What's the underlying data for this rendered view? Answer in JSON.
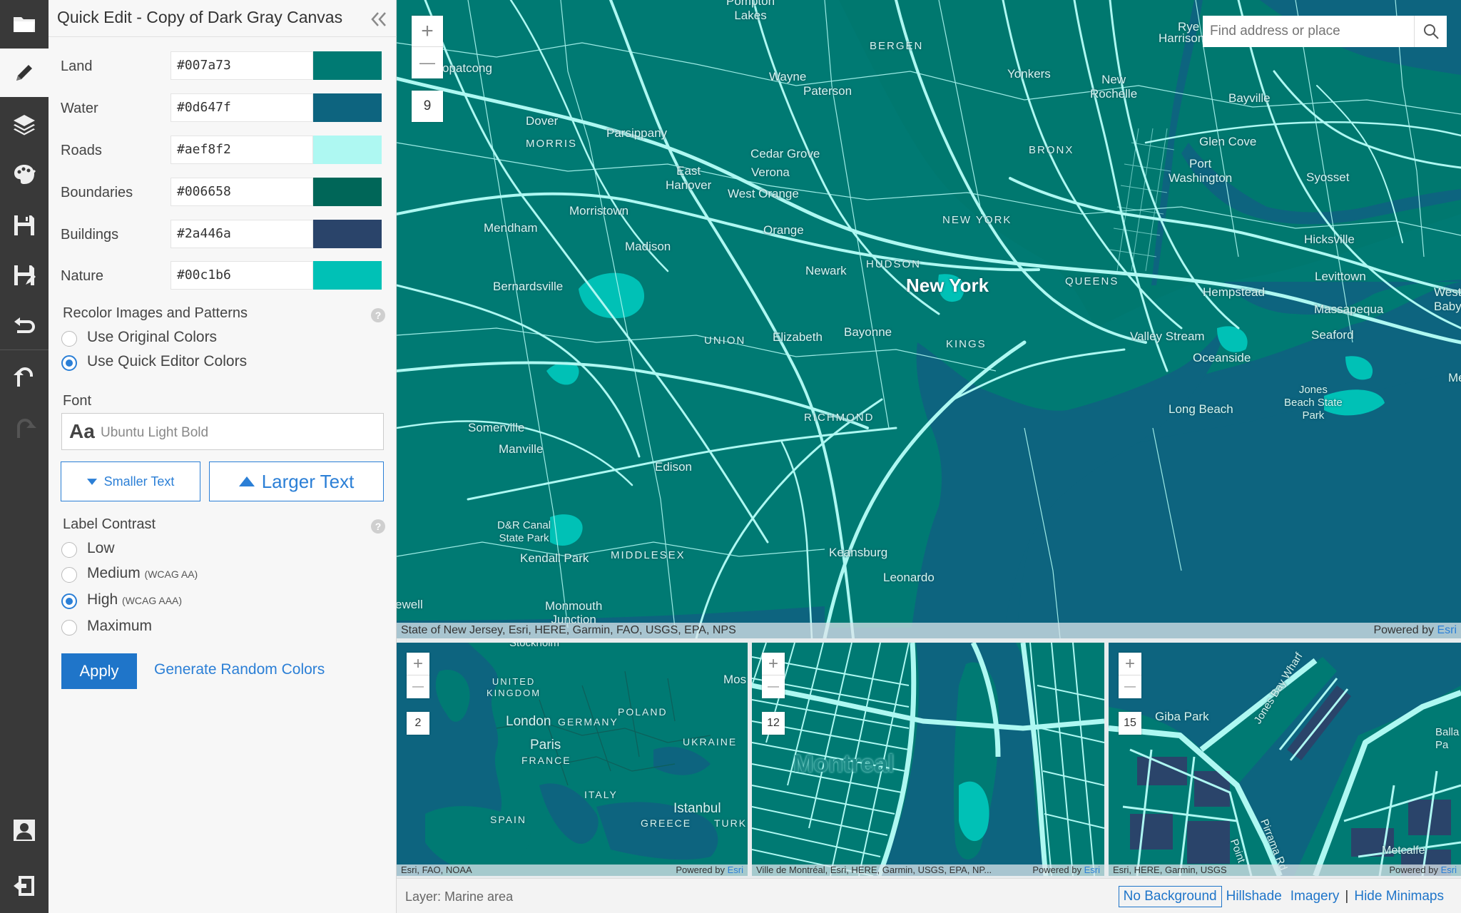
{
  "panel": {
    "title": "Quick Edit - Copy of Dark Gray Canvas",
    "colors": [
      {
        "label": "Land",
        "hex": "#007a73"
      },
      {
        "label": "Water",
        "hex": "#0d647f"
      },
      {
        "label": "Roads",
        "hex": "#aef8f2"
      },
      {
        "label": "Boundaries",
        "hex": "#006658"
      },
      {
        "label": "Buildings",
        "hex": "#2a446a"
      },
      {
        "label": "Nature",
        "hex": "#00c1b6"
      }
    ],
    "recolor": {
      "label": "Recolor Images and Patterns",
      "options": [
        "Use Original Colors",
        "Use Quick Editor Colors"
      ],
      "selected": "Use Quick Editor Colors"
    },
    "font": {
      "label": "Font",
      "icon_text": "Aa",
      "value": "Ubuntu Light Bold"
    },
    "smaller_text": "Smaller Text",
    "larger_text": "Larger Text",
    "contrast": {
      "label": "Label Contrast",
      "options": [
        {
          "label": "Low",
          "note": ""
        },
        {
          "label": "Medium",
          "note": "(WCAG AA)"
        },
        {
          "label": "High",
          "note": "(WCAG AAA)"
        },
        {
          "label": "Maximum",
          "note": ""
        }
      ],
      "selected": "High"
    },
    "help": "?",
    "apply": "Apply",
    "random": "Generate Random Colors"
  },
  "toolbar": {
    "icons": [
      "folder-icon",
      "pencil-icon",
      "layers-icon",
      "palette-icon",
      "save-icon",
      "save-as-icon",
      "revert-icon",
      "undo-icon",
      "redo-icon",
      "user-icon",
      "sign-out-icon"
    ],
    "active": "pencil-icon"
  },
  "map": {
    "zoom_in": "+",
    "zoom_out": "—",
    "zoom_level": "9",
    "search_placeholder": "Find address or place",
    "attribution": "State of New Jersey, Esri, HERE, Garmin, FAO, USGS, EPA, NPS",
    "powered_by": "Powered by",
    "powered_by_brand": "Esri",
    "labels": {
      "pompton_lakes": "Pompton\nLakes",
      "bergen": "BERGEN",
      "rye": "Rye",
      "harrison": "Harrison",
      "opatcong": "opatcong",
      "wayne": "Wayne",
      "paterson": "Paterson",
      "yonkers": "Yonkers",
      "new_rochelle": "New\nRochelle",
      "bayville": "Bayville",
      "dover": "Dover",
      "morris": "MORRIS",
      "parsippany": "Parsippany",
      "cedar_grove": "Cedar Grove",
      "verona": "Verona",
      "bronx": "BRONX",
      "glen_cove": "Glen Cove",
      "east_hanover": "East\nHanover",
      "west_orange": "West Orange",
      "port_washington": "Port\nWashington",
      "syosset": "Syosset",
      "morristown": "Morristown",
      "new_york_caps": "NEW YORK",
      "mendham": "Mendham",
      "orange": "Orange",
      "madison": "Madison",
      "hicksville": "Hicksville",
      "hudson": "HUDSON",
      "newark": "Newark",
      "new_york": "New York",
      "queens": "QUEENS",
      "levittown": "Levittown",
      "bernardsville": "Bernardsville",
      "hempstead": "Hempstead",
      "west_babylon": "West\nBabylon",
      "massapequa": "Massapequa",
      "bayonne": "Bayonne",
      "union": "UNION",
      "elizabeth": "Elizabeth",
      "kings": "KINGS",
      "valley_stream": "Valley Stream",
      "seaford": "Seaford",
      "oceanside": "Oceanside",
      "me": "Me",
      "jones_beach": "Jones\nBeach State\nPark",
      "richmond": "RICHMOND",
      "long_beach": "Long Beach",
      "somerville": "Somerville",
      "manville": "Manville",
      "edison": "Edison",
      "dr_canal": "D&R Canal\nState Park",
      "kendall_park": "Kendall Park",
      "middlesex": "MIDDLESEX",
      "keansburg": "Keansburg",
      "leonardo": "Leonardo",
      "ewell": "ewell",
      "monmouth_junction": "Monmouth\nJunction"
    }
  },
  "minimaps": [
    {
      "zoom_level": "2",
      "attribution": "Esri, FAO, NOAA",
      "labels": {
        "stockholm": "Stockholm",
        "uk": "UNITED\nKINGDOM",
        "mos": "Mos",
        "poland": "POLAND",
        "london": "London",
        "germany": "GERMANY",
        "ukraine": "UKRAINE",
        "paris": "Paris",
        "france": "FRANCE",
        "italy": "ITALY",
        "istanbul": "Istanbul",
        "spain": "SPAIN",
        "greece": "GREECE",
        "turk": "TURK"
      }
    },
    {
      "zoom_level": "12",
      "attribution": "Ville de Montréal, Esri, HERE, Garmin, USGS, EPA, NP...",
      "labels": {
        "montreal": "Montreal"
      }
    },
    {
      "zoom_level": "15",
      "attribution": "Esri, HERE, Garmin, USGS",
      "labels": {
        "giba_park": "Giba Park",
        "jones_bay_wharf": "Jones Bay Wharf",
        "pirrama": "Pirrama Rd",
        "metcalfe": "Metcalfe",
        "balla": "Balla\nPa",
        "point": "Point"
      }
    }
  ],
  "status": {
    "layer": "Layer: Marine area",
    "toggles": [
      "No Background",
      "Hillshade",
      "Imagery",
      "Hide Minimaps"
    ],
    "selected_toggle": "No Background"
  }
}
